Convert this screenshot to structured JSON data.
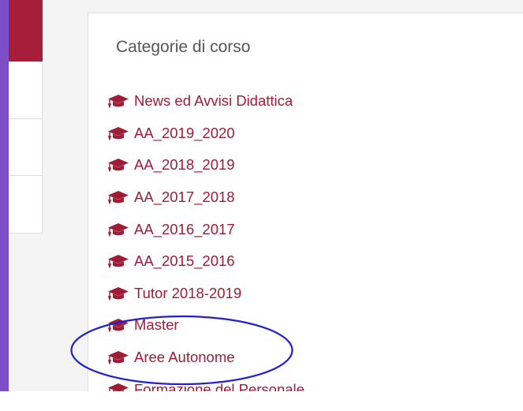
{
  "block": {
    "title": "Categorie di corso",
    "categories": [
      {
        "label": "News ed Avvisi Didattica",
        "icon": "graduation-cap-icon"
      },
      {
        "label": "AA_2019_2020",
        "icon": "graduation-cap-icon"
      },
      {
        "label": "AA_2018_2019",
        "icon": "graduation-cap-icon"
      },
      {
        "label": "AA_2017_2018",
        "icon": "graduation-cap-icon"
      },
      {
        "label": "AA_2016_2017",
        "icon": "graduation-cap-icon"
      },
      {
        "label": "AA_2015_2016",
        "icon": "graduation-cap-icon"
      },
      {
        "label": "Tutor 2018-2019",
        "icon": "graduation-cap-icon"
      },
      {
        "label": "Master",
        "icon": "graduation-cap-icon"
      },
      {
        "label": "Aree Autonome",
        "icon": "graduation-cap-icon"
      },
      {
        "label": "Formazione del Personale",
        "icon": "graduation-cap-icon"
      }
    ]
  },
  "colors": {
    "link": "#a01c35",
    "nav_active": "#a71e3a",
    "frame_left": "#7c4fc9",
    "annotation": "#1f1fd6"
  }
}
